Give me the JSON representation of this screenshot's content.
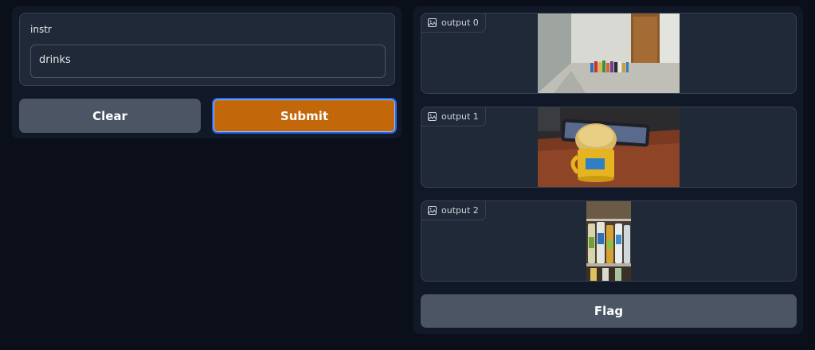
{
  "input": {
    "label": "instr",
    "value": "drinks"
  },
  "buttons": {
    "clear_label": "Clear",
    "submit_label": "Submit",
    "flag_label": "Flag"
  },
  "outputs": [
    {
      "label": "output 0",
      "icon": "image-icon"
    },
    {
      "label": "output 1",
      "icon": "image-icon"
    },
    {
      "label": "output 2",
      "icon": "image-icon"
    }
  ],
  "colors": {
    "background": "#0b0f19",
    "panel": "#111827",
    "block": "#1f2937",
    "submit": "#c2680a",
    "secondary_button": "#4b5563",
    "focus_ring": "#2563eb"
  }
}
